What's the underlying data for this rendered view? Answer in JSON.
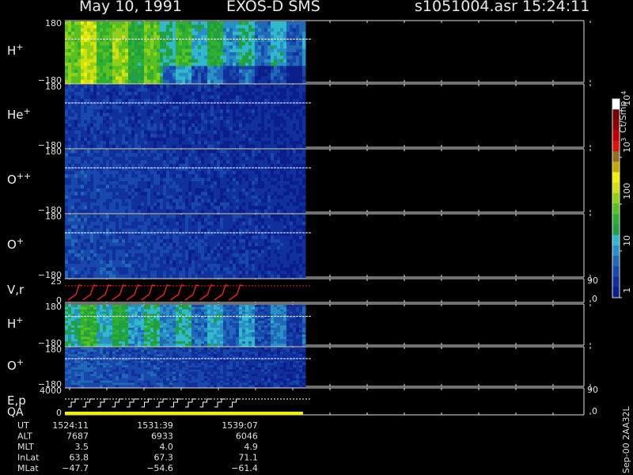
{
  "header": {
    "date": "May 10, 1991",
    "instrument": "EXOS-D SMS",
    "file": "s1051004.asr",
    "time": "15:24:11"
  },
  "colorbar": {
    "title": "Ct/Smp",
    "ticks": [
      {
        "label": "1",
        "value": 1
      },
      {
        "label": "10",
        "value": 10
      },
      {
        "label": "100",
        "value": 100
      },
      {
        "label": "10",
        "sup": "3",
        "value": 1000
      },
      {
        "label": "10",
        "sup": "4",
        "value": 10000
      }
    ],
    "colors": [
      "#0a1f8c",
      "#10309c",
      "#1848ac",
      "#2068b8",
      "#2890c4",
      "#30b8cc",
      "#20a040",
      "#30b030",
      "#58c020",
      "#90d018",
      "#d0e010",
      "#f0f000",
      "#c8a800",
      "#907020",
      "#e01010",
      "#c00000",
      "#900000",
      "#700000",
      "#ffffff"
    ]
  },
  "chart_data": {
    "type": "heatmap",
    "x_range_minutes": [
      1524.18,
      1570
    ],
    "data_end_minutes": 1545.2,
    "panels": [
      {
        "id": "h1",
        "label": "H",
        "sup": "+",
        "ytop": "180",
        "ybot": "−180",
        "base_level": 0.82,
        "right_axis": false
      },
      {
        "id": "he",
        "label": "He",
        "sup": "+",
        "ytop": "180",
        "ybot": "−180",
        "base_level": 0.12,
        "right_axis": false
      },
      {
        "id": "opp",
        "label": "O",
        "sup": "++",
        "ytop": "180",
        "ybot": "−180",
        "base_level": 0.16,
        "right_axis": false
      },
      {
        "id": "o1",
        "label": "O",
        "sup": "+",
        "ytop": "180",
        "ybot": "−180",
        "base_level": 0.18,
        "right_axis": false
      },
      {
        "id": "vr",
        "label": "V,r",
        "sup": "",
        "ytop": "25",
        "ybot": "0",
        "rtop": "90",
        "rbot": "0",
        "right_axis": true
      },
      {
        "id": "h2",
        "label": "H",
        "sup": "+",
        "ytop": "180",
        "ybot": "−180",
        "base_level": 0.55,
        "right_axis": false
      },
      {
        "id": "o2",
        "label": "O",
        "sup": "+",
        "ytop": "180",
        "ybot": "−180",
        "base_level": 0.22,
        "right_axis": false
      },
      {
        "id": "ep",
        "label": "E,p",
        "label2": "QA",
        "sup": "",
        "ytop": "4000",
        "ybot": "0",
        "rtop": "90",
        "rbot": "0",
        "right_axis": true
      }
    ],
    "orbit_table": {
      "rows": [
        {
          "name": "UT",
          "values": [
            "1524:11",
            "1531:39",
            "1539:07"
          ]
        },
        {
          "name": "ALT",
          "values": [
            "7687",
            "6933",
            "6046"
          ]
        },
        {
          "name": "MLT",
          "values": [
            "3.5",
            "4.0",
            "4.9"
          ]
        },
        {
          "name": "InLat",
          "values": [
            "63.8",
            "67.3",
            "71.1"
          ]
        },
        {
          "name": "MLat",
          "values": [
            "−47.7",
            "−54.6",
            "−61.4"
          ]
        }
      ],
      "time_minutes": [
        1524.18,
        1531.65,
        1539.12
      ]
    }
  },
  "footer": {
    "tag": "Sep-00 2AA32L"
  }
}
